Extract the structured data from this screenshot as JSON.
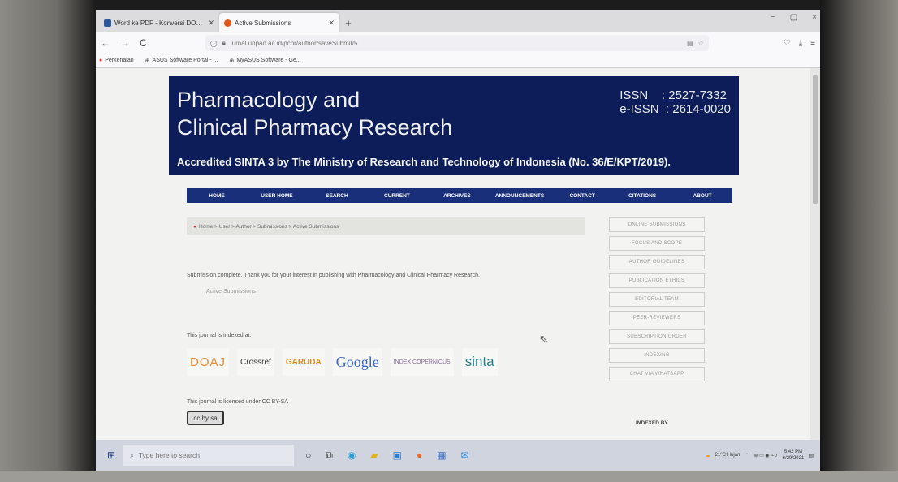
{
  "browser": {
    "tabs": [
      {
        "title": "Word ke PDF - Konversi DOC ke P",
        "icon_color": "#2b579a"
      },
      {
        "title": "Active Submissions",
        "icon_color": "#e05a1c"
      }
    ],
    "new_tab": "+",
    "window_controls": [
      "−",
      "▢",
      "×"
    ],
    "nav": {
      "back": "←",
      "forward": "→",
      "reload": "C"
    },
    "url": "jurnal.unpad.ac.id/pcpr/author/saveSubmit/5",
    "bookmarks": [
      "Perkenalan",
      "ASUS Software Portal - ...",
      "MyASUS Software - Ge..."
    ]
  },
  "journal": {
    "title_line1": "Pharmacology and",
    "title_line2": "Clinical Pharmacy Research",
    "issn": "ISSN    : 2527-7332\ne-ISSN  : 2614-0020",
    "accreditation": "Accredited SINTA 3 by The Ministry of Research and Technology of Indonesia (No. 36/E/KPT/2019)."
  },
  "menu": [
    "HOME",
    "USER HOME",
    "SEARCH",
    "CURRENT",
    "ARCHIVES",
    "ANNOUNCEMENTS",
    "CONTACT",
    "CITATIONS",
    "ABOUT"
  ],
  "breadcrumb": "Home > User > Author > Submissions > Active Submissions",
  "content": {
    "message": "Submission complete. Thank you for your interest in publishing with Pharmacology and Clinical Pharmacy Research.",
    "active_link": "Active Submissions",
    "indexed_label": "This journal is indexed at:",
    "license": "This journal is licensed under CC BY-SA",
    "cc_badge": "cc by sa"
  },
  "logos": [
    "DOAJ",
    "Crossref",
    "GARUDA",
    "Google",
    "INDEX COPERNICUS",
    "sinta"
  ],
  "sidebar": [
    "ONLINE SUBMISSIONS",
    "FOCUS AND SCOPE",
    "AUTHOR GUIDELINES",
    "PUBLICATION ETHICS",
    "EDITORIAL TEAM",
    "PEER-REVIEWERS",
    "SUBSCRIPTION/ORDER",
    "INDEXING",
    "CHAT VIA WHATSAPP"
  ],
  "indexed_by": "INDEXED BY",
  "taskbar": {
    "search_placeholder": "Type here to search",
    "weather": "21°C Hujan",
    "time": "5:42 PM",
    "date": "6/29/2021"
  }
}
